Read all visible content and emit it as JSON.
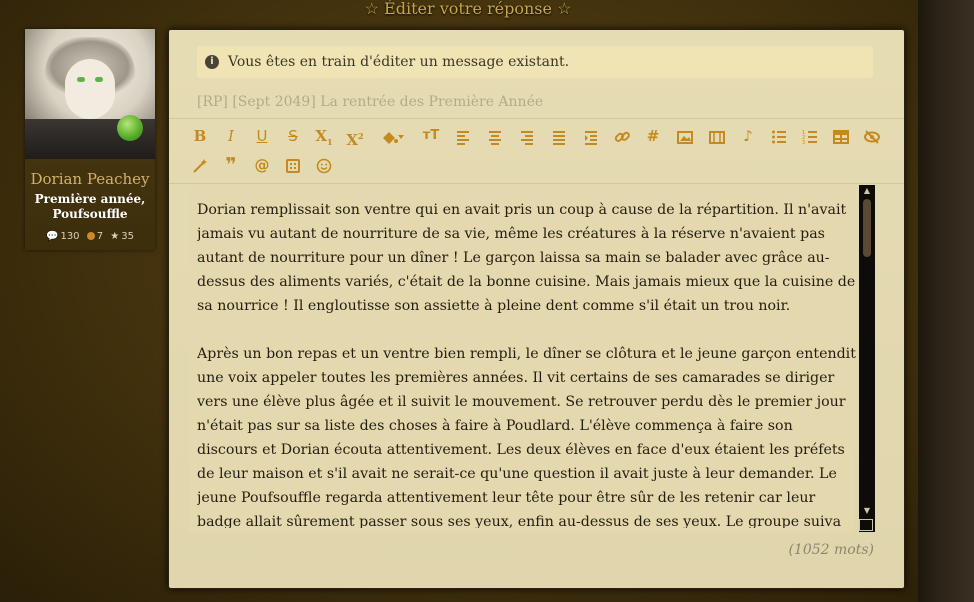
{
  "page": {
    "title": "☆ Éditer votre réponse ☆"
  },
  "profile": {
    "username": "Dorian Peachey",
    "rank_line1": "Première année,",
    "rank_line2": "Poufsouffle",
    "stats": {
      "messages": "130",
      "coins": "7",
      "stars": "35"
    }
  },
  "editor": {
    "info_icon": "info-circle-icon",
    "info_text": "Vous êtes en train d'éditer un message existant.",
    "subject": "[RP] [Sept 2049] La rentrée des Première Année",
    "accent_color": "#c58a1f",
    "toolbar_row1": [
      "bold",
      "italic",
      "underline",
      "strikethrough",
      "subscript",
      "superscript",
      "color",
      "font-size",
      "align-left",
      "align-center",
      "align-right",
      "justify",
      "indent",
      "link",
      "hashtag",
      "image",
      "video",
      "music",
      "bullet-list",
      "numbered-list",
      "table",
      "hide"
    ],
    "toolbar_row2": [
      "magic-wand",
      "quote",
      "mention",
      "spoiler",
      "emoji"
    ],
    "paragraphs": [
      "Dorian remplissait son ventre qui en avait pris un coup à cause de la répartition. Il n'avait jamais vu autant de nourriture de sa vie, même les créatures à la réserve n'avaient pas autant de nourriture pour un dîner ! Le garçon laissa sa main se balader avec grâce au-dessus des aliments variés, c'était de la bonne cuisine. Mais jamais mieux que la cuisine de sa nourrice ! Il engloutisse son assiette à pleine dent comme s'il était un trou noir.",
      "Après un bon repas et un ventre bien rempli, le dîner se clôtura et le jeune garçon entendit une voix appeler toutes les premières années. Il vit certains de ses camarades se diriger vers une élève plus âgée et il suivit le mouvement. Se retrouver perdu dès le premier jour n'était pas sur sa liste des choses à faire à Poudlard. L'élève commença à faire son discours et Dorian écouta attentivement. Les deux élèves en face d'eux étaient les préfets de leur maison et s'il avait ne serait-ce qu'une question il avait juste à leur demander. Le jeune Poufsouffle regarda attentivement leur tête pour être sûr de les retenir car leur badge allait sûrement passer sous ses yeux, enfin au-dessus de ses yeux. Le groupe suiva les deux préfets dans les couloirs du"
    ],
    "word_count": "(1052 mots)"
  }
}
